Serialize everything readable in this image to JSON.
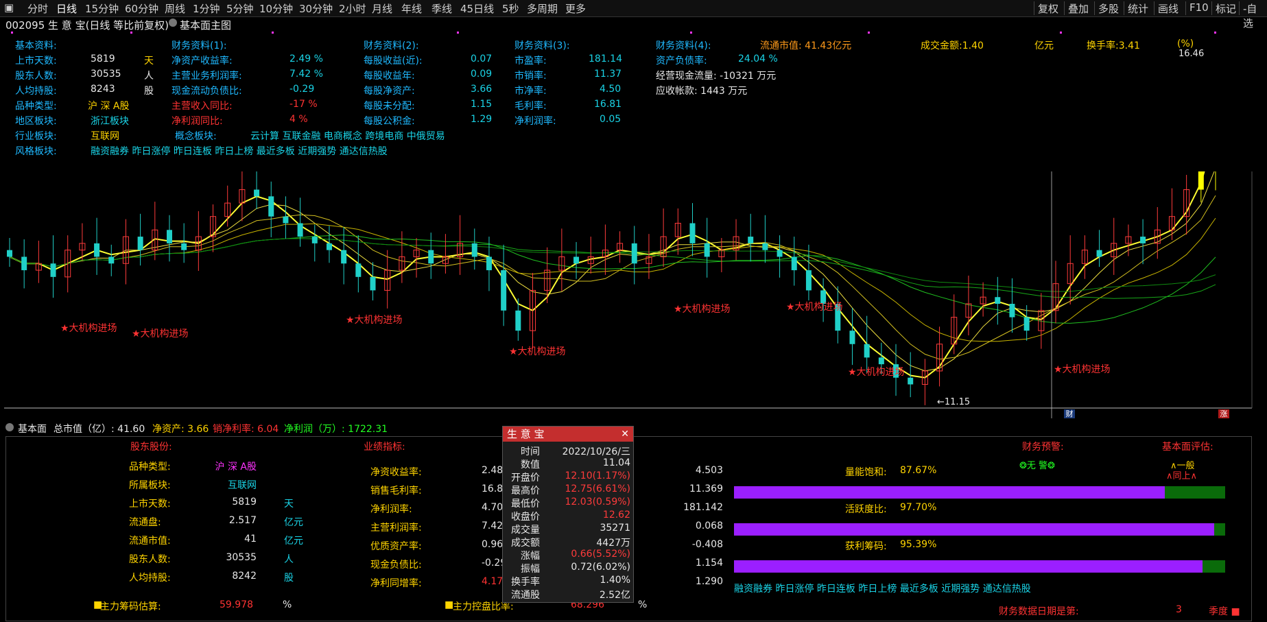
{
  "toolbar": {
    "left_items": [
      "分时",
      "日线",
      "15分钟",
      "60分钟",
      "周线",
      "1分钟",
      "5分钟",
      "10分钟",
      "30分钟",
      "2小时",
      "月线",
      "年线",
      "季线",
      "45日线",
      "5秒",
      "多周期",
      "更多"
    ],
    "right_items": [
      "复权",
      "叠加",
      "多股",
      "统计",
      "画线",
      "F10",
      "标记",
      "-自选"
    ]
  },
  "header": {
    "stock_title": "002095 生 意 宝(日线 等比前复权)",
    "panel_title": "基本面主图"
  },
  "fund": {
    "col1_title": "基本资料:",
    "col1": [
      {
        "k": "上市天数:",
        "v": "5819",
        "u": "天"
      },
      {
        "k": "股东人数:",
        "v": "30535",
        "u": "人"
      },
      {
        "k": "人均持股:",
        "v": "8243",
        "u": "股"
      },
      {
        "k": "品种类型:",
        "v": "沪 深 A股"
      },
      {
        "k": "地区板块:",
        "v": "浙江板块"
      },
      {
        "k": "行业板块:",
        "v": "互联网"
      },
      {
        "k": "风格板块:",
        "v": "融资融券 昨日涨停 昨日连板 昨日上榜 最近多板 近期强势 通达信热股"
      }
    ],
    "concept_label": "概念板块:",
    "concept_value": "云计算 互联金融 电商概念 跨境电商 中俄贸易",
    "col2_title": "财务资料(1):",
    "col2": [
      {
        "k": "净资产收益率:",
        "v": "2.49 %"
      },
      {
        "k": "主营业务利润率:",
        "v": "7.42 %"
      },
      {
        "k": "现金流动负债比:",
        "v": "-0.29"
      },
      {
        "k": "主营收入同比:",
        "v": "-17 %"
      },
      {
        "k": "净利润同比:",
        "v": "4 %"
      }
    ],
    "col3_title": "财务资料(2):",
    "col3": [
      {
        "k": "每股收益(近):",
        "v": "0.07"
      },
      {
        "k": "每股收益年:",
        "v": "0.09"
      },
      {
        "k": "每股净资产:",
        "v": "3.66"
      },
      {
        "k": "每股未分配:",
        "v": "1.15"
      },
      {
        "k": "每股公积金:",
        "v": "1.29"
      }
    ],
    "col4_title": "财务资料(3):",
    "col4": [
      {
        "k": "市盈率:",
        "v": "181.14"
      },
      {
        "k": "市销率:",
        "v": "11.37"
      },
      {
        "k": "市净率:",
        "v": "4.50"
      },
      {
        "k": "毛利率:",
        "v": "16.81"
      },
      {
        "k": "净利润率:",
        "v": "0.05"
      }
    ],
    "col5_title": "财务资料(4):",
    "col5_row1_k": "资产负债率:",
    "col5_row1_v": "24.04 %",
    "col5_row2": "经营现金流量: -10321 万元",
    "col5_row3": "应收帐款: 1443 万元",
    "float_mv": "流通市值: 41.43亿元",
    "turnover_amt": "成交金额:1.40",
    "yi": "亿元",
    "turnover_rate": "换手率:3.41",
    "pct": "(%)"
  },
  "chart_labels": {
    "high": "16.46",
    "low": "←11.15",
    "signal": "★大机构进场",
    "marker_cai": "财",
    "marker_zhang": "涨"
  },
  "lower_header": {
    "toggle": "基本面",
    "mv": "总市值（亿）: 41.60",
    "na": "净资产: 3.66",
    "npm": "销净利率: 6.04",
    "np": "净利润（万）: 1722.31"
  },
  "lower": {
    "shareholder_title": "股东股份:",
    "left_rows": [
      {
        "k": "品种类型:",
        "v": "沪 深 A股",
        "u": ""
      },
      {
        "k": "所属板块:",
        "v": "互联网",
        "u": ""
      },
      {
        "k": "上市天数:",
        "v": "5819",
        "u": "天"
      },
      {
        "k": "流通盘:",
        "v": "2.517",
        "u": "亿元"
      },
      {
        "k": "流通市值:",
        "v": "41",
        "u": "亿元"
      },
      {
        "k": "股东人数:",
        "v": "30535",
        "u": "人"
      },
      {
        "k": "人均持股:",
        "v": "8242",
        "u": "股"
      }
    ],
    "main_chip_label": "主力筹码估算:",
    "main_chip_value": "59.978",
    "main_chip_unit": "%",
    "perf_title": "业绩指标:",
    "mid_rows": [
      {
        "k": "净资收益率:",
        "v": "2.48"
      },
      {
        "k": "销售毛利率:",
        "v": "16.81"
      },
      {
        "k": "净利润率:",
        "v": "4.70"
      },
      {
        "k": "主营利润率:",
        "v": "7.42"
      },
      {
        "k": "优质资产率:",
        "v": "0.96"
      },
      {
        "k": "现金负债比:",
        "v": "-0.29"
      },
      {
        "k": "净利同增率:",
        "v": "4.17"
      }
    ],
    "control_label": "主力控盘比率:",
    "control_value": "68.296",
    "control_unit": "%",
    "right_vals": [
      "4.503",
      "11.369",
      "181.142",
      "0.068",
      "-0.408",
      "1.154",
      "1.290"
    ],
    "warn_title": "财务预警:",
    "warn_value": "❂无 警❂",
    "estimate_title": "基本面评估:",
    "estimate_value": "∧一般",
    "estimate_sub": "∧同上∧",
    "bars": [
      {
        "label": "量能饱和:",
        "value": "87.67%",
        "frac": 0.8767
      },
      {
        "label": "活跃度比:",
        "value": "97.70%",
        "frac": 0.977
      },
      {
        "label": "获利筹码:",
        "value": "95.39%",
        "frac": 0.9539
      }
    ],
    "style_text": "融资融券 昨日涨停 昨日连板 昨日上榜 最近多板 近期强势 通达信热股",
    "report_label": "财务数据日期是第:",
    "report_value": "3",
    "report_unit": "季度 ■"
  },
  "popup": {
    "title": "生 意 宝",
    "rows": [
      {
        "k": "时间",
        "v": "2022/10/26/三",
        "c": "#e8e8e8"
      },
      {
        "k": "数值",
        "v": "11.04",
        "c": "#e8e8e8"
      },
      {
        "k": "开盘价",
        "v": "12.10(1.17%)",
        "c": "#ff3b3b"
      },
      {
        "k": "最高价",
        "v": "12.75(6.61%)",
        "c": "#ff3b3b"
      },
      {
        "k": "最低价",
        "v": "12.03(0.59%)",
        "c": "#ff3b3b"
      },
      {
        "k": "收盘价",
        "v": "12.62",
        "c": "#ff3b3b"
      },
      {
        "k": "成交量",
        "v": "35271",
        "c": "#e8e8e8"
      },
      {
        "k": "成交额",
        "v": "4427万",
        "c": "#e8e8e8"
      },
      {
        "k": "涨幅",
        "v": "0.66(5.52%)",
        "c": "#ff3b3b"
      },
      {
        "k": "振幅",
        "v": "0.72(6.02%)",
        "c": "#e8e8e8"
      },
      {
        "k": "换手率",
        "v": "1.40%",
        "c": "#e8e8e8"
      },
      {
        "k": "流通股",
        "v": "2.52亿",
        "c": "#e8e8e8"
      }
    ]
  },
  "chart_data": {
    "type": "candlestick",
    "y_range": [
      11.15,
      16.46
    ],
    "closes": [
      13.3,
      13.1,
      13.2,
      13.0,
      13.4,
      13.5,
      13.3,
      13.2,
      13.6,
      13.4,
      13.7,
      13.5,
      13.4,
      13.6,
      13.9,
      14.1,
      14.3,
      14.2,
      13.9,
      13.8,
      13.6,
      13.5,
      13.4,
      13.2,
      13.0,
      12.8,
      13.1,
      13.3,
      13.4,
      13.2,
      13.3,
      13.5,
      13.3,
      13.1,
      12.5,
      12.2,
      12.8,
      13.1,
      13.3,
      13.2,
      13.3,
      13.4,
      13.5,
      13.2,
      13.3,
      13.6,
      13.8,
      13.5,
      13.3,
      13.4,
      13.6,
      13.5,
      13.4,
      13.3,
      13.1,
      12.8,
      12.6,
      12.2,
      12.0,
      11.8,
      11.7,
      11.5,
      11.4,
      11.6,
      12.0,
      12.4,
      12.6,
      12.7,
      12.6,
      12.4,
      12.2,
      12.5,
      12.9,
      13.2,
      13.4,
      13.3,
      13.5,
      13.6,
      13.5,
      13.7,
      13.9,
      14.3,
      15.0,
      16.2
    ]
  }
}
